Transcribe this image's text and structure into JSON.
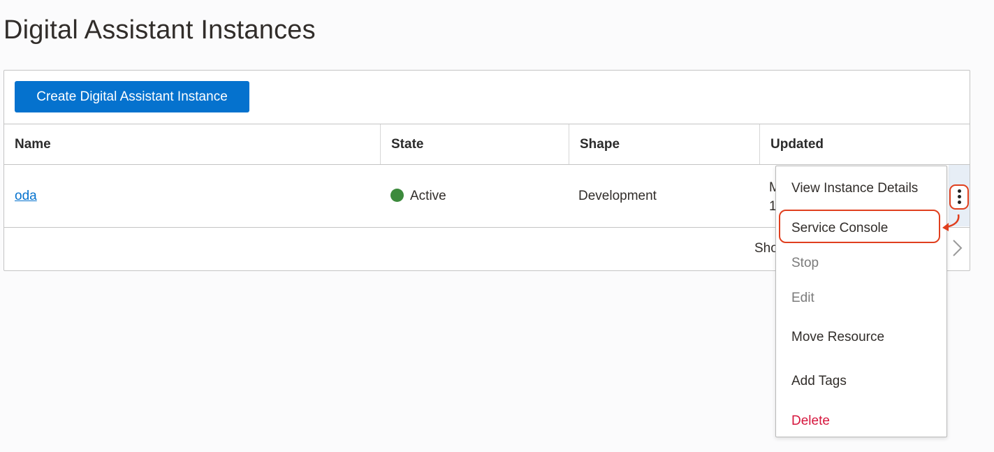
{
  "page": {
    "title": "Digital Assistant Instances"
  },
  "toolbar": {
    "create_label": "Create Digital Assistant Instance"
  },
  "table": {
    "columns": [
      "Name",
      "State",
      "Shape",
      "Updated"
    ],
    "rows": [
      {
        "name": "oda",
        "state": "Active",
        "shape": "Development",
        "updated_line1": "M",
        "updated_line2": "1"
      }
    ]
  },
  "footer": {
    "showing_text": "Sho"
  },
  "menu": {
    "items": [
      {
        "label": "View Instance Details"
      },
      {
        "label": "Service Console"
      },
      {
        "label": "Stop"
      },
      {
        "label": "Edit"
      },
      {
        "label": "Move Resource"
      },
      {
        "label": "Add Tags"
      },
      {
        "label": "Delete"
      }
    ]
  },
  "colors": {
    "primary": "#0572ce",
    "active_status": "#3c8a3c",
    "annotation": "#e03f1e",
    "danger": "#d6163d"
  },
  "icons": [
    "kebab-menu-icon",
    "chevron-right-icon",
    "annotation-arrow-icon",
    "status-dot-icon"
  ]
}
